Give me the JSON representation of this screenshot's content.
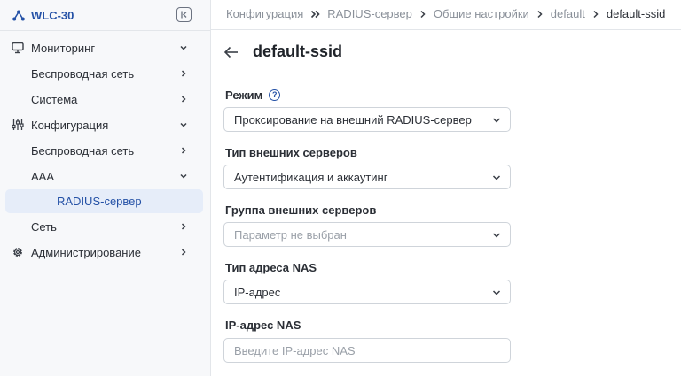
{
  "brand": {
    "name": "WLC-30"
  },
  "sidebar": {
    "items": [
      {
        "label": "Мониторинг",
        "icon": "monitor-icon",
        "chevron": "down"
      },
      {
        "label": "Беспроводная сеть",
        "chevron": "right"
      },
      {
        "label": "Система",
        "chevron": "right"
      },
      {
        "label": "Конфигурация",
        "icon": "sliders-icon",
        "chevron": "down"
      },
      {
        "label": "Беспроводная сеть",
        "chevron": "right"
      },
      {
        "label": "AAA",
        "chevron": "down"
      },
      {
        "label": "RADIUS-сервер",
        "active": true
      },
      {
        "label": "Сеть",
        "chevron": "right"
      },
      {
        "label": "Администрирование",
        "icon": "gear-icon",
        "chevron": "right"
      }
    ]
  },
  "breadcrumb": [
    "Конфигурация",
    "RADIUS-сервер",
    "Общие настройки",
    "default",
    "default-ssid"
  ],
  "page": {
    "title": "default-ssid"
  },
  "form": {
    "mode": {
      "label": "Режим",
      "value": "Проксирование на внешний RADIUS-сервер"
    },
    "server_type": {
      "label": "Тип внешних серверов",
      "value": "Аутентификация и аккаутинг"
    },
    "server_group": {
      "label": "Группа внешних серверов",
      "placeholder": "Параметр не выбран"
    },
    "nas_type": {
      "label": "Тип адреса NAS",
      "value": "IP-адрес"
    },
    "nas_ip": {
      "label": "IP-адрес NAS",
      "placeholder": "Введите IP-адрес NAS"
    }
  },
  "colors": {
    "accent": "#2451a6",
    "active_bg": "#e6edf9",
    "sidebar_bg": "#f7f8fa"
  }
}
